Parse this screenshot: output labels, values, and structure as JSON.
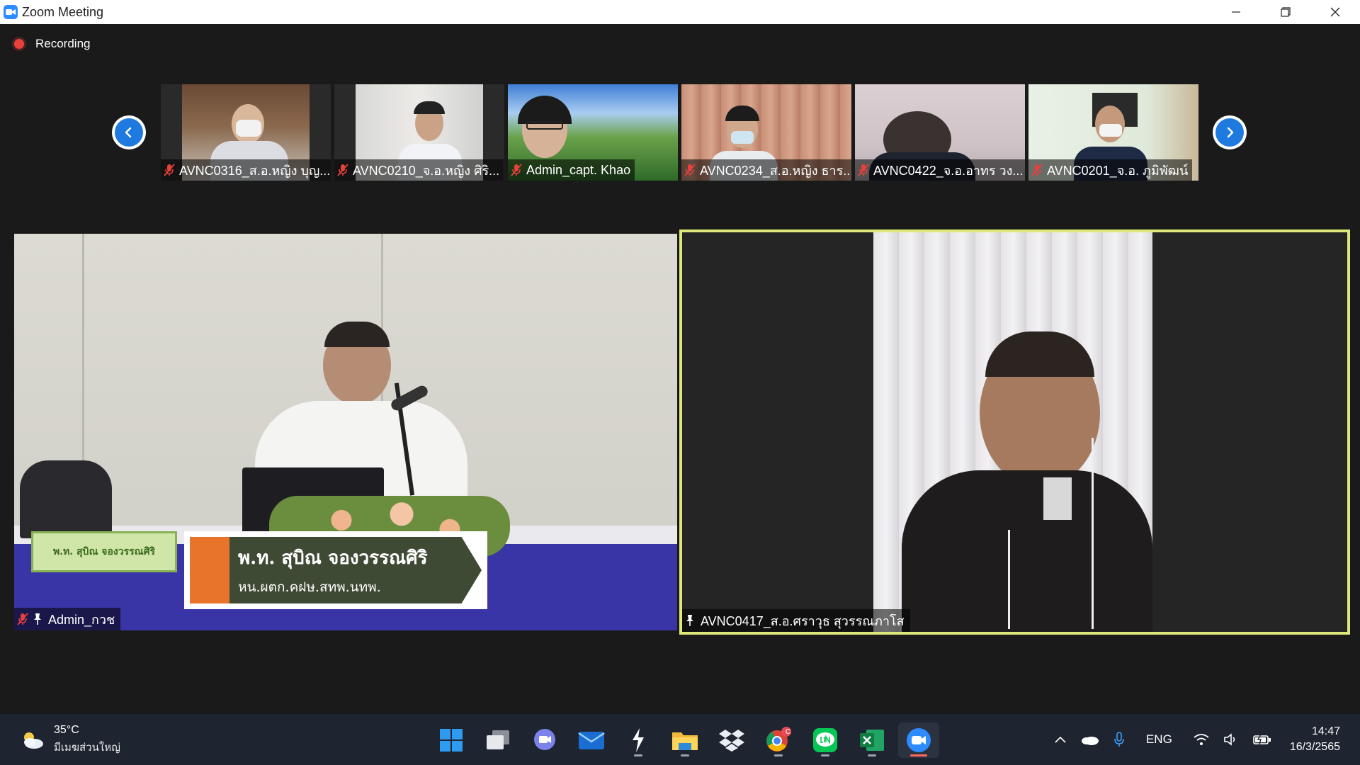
{
  "window": {
    "title": "Zoom Meeting",
    "controls": [
      "minimize",
      "restore",
      "close"
    ]
  },
  "meeting": {
    "recording_label": "Recording",
    "thumbnails": [
      {
        "name": "AVNC0316_ส.อ.หญิง บุญ...",
        "muted": true
      },
      {
        "name": "AVNC0210_จ.อ.หญิง ศิริ...",
        "muted": true
      },
      {
        "name": "Admin_capt. Khao",
        "muted": true
      },
      {
        "name": "AVNC0234_ส.อ.หญิง ธาร...",
        "muted": true
      },
      {
        "name": "AVNC0422_จ.อ.อาทร วง...",
        "muted": true
      },
      {
        "name": "AVNC0201_จ.อ. ภูมิพัฒน์",
        "muted": true
      }
    ],
    "left_tile": {
      "name": "Admin_กวช",
      "muted": true,
      "pinned": true,
      "nameplate_line1": "พ.ท. สุบิณ  จองวรรณศิริ",
      "nameplate_line2": "หน.ผตก.คฝษ.สทพ.นทพ.",
      "small_plate": "พ.ท. สุบิณ  จองวรรณศิริ"
    },
    "right_tile": {
      "name": "AVNC0417_ส.อ.ศราวุธ สุวรรณภาโส",
      "pinned": true,
      "active_speaker": true,
      "highlight_color": "#dde77a"
    }
  },
  "taskbar": {
    "weather": {
      "temp": "35°C",
      "condition": "มีเมฆส่วนใหญ่"
    },
    "apps": [
      "start",
      "task-view",
      "teams",
      "mail",
      "app-s",
      "file-explorer",
      "dropbox",
      "chrome",
      "line",
      "excel",
      "zoom"
    ],
    "chrome_badge": "C",
    "language": "ENG",
    "time": "14:47",
    "date": "16/3/2565"
  },
  "colors": {
    "accent": "#2d8cff",
    "recording": "#e8413c",
    "active_border": "#dde77a",
    "mute": "#e8413c"
  }
}
